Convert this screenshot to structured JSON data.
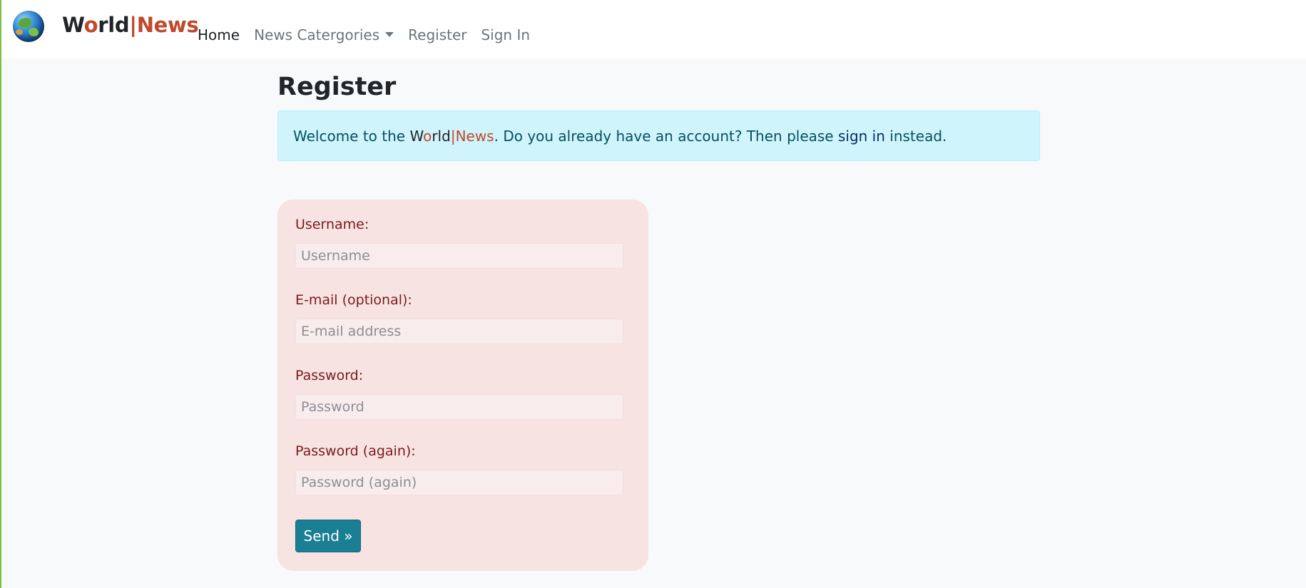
{
  "brand": {
    "logo_icon": "globe-icon",
    "name_w": "W",
    "name_o": "o",
    "name_rld": "rld",
    "name_sep": "|",
    "name_news": "News"
  },
  "nav": {
    "items": [
      {
        "label": "Home",
        "active": true
      },
      {
        "label": "News Catergories",
        "dropdown": true
      },
      {
        "label": "Register"
      },
      {
        "label": "Sign In"
      }
    ],
    "dropdown_icon": "caret-down-icon"
  },
  "page": {
    "title": "Register"
  },
  "alert": {
    "prefix": "Welcome to the ",
    "brand_w": "W",
    "brand_o": "o",
    "brand_rld": "rld",
    "brand_sep": "|",
    "brand_news": "News",
    "middle": ". Do you already have an account? Then please ",
    "link": "sign in",
    "suffix": " instead."
  },
  "form": {
    "fields": [
      {
        "label": "Username:",
        "placeholder": "Username",
        "value": ""
      },
      {
        "label": "E-mail (optional):",
        "placeholder": "E-mail address",
        "value": ""
      },
      {
        "label": "Password:",
        "placeholder": "Password",
        "value": ""
      },
      {
        "label": "Password (again):",
        "placeholder": "Password (again)",
        "value": ""
      }
    ],
    "submit_label": "Send »"
  },
  "colors": {
    "accent": "#c0492b",
    "alert_bg": "#cff4fc",
    "form_bg": "#f8e3e3",
    "button_bg": "#1a7f93",
    "label_color": "#7a1b1b"
  }
}
